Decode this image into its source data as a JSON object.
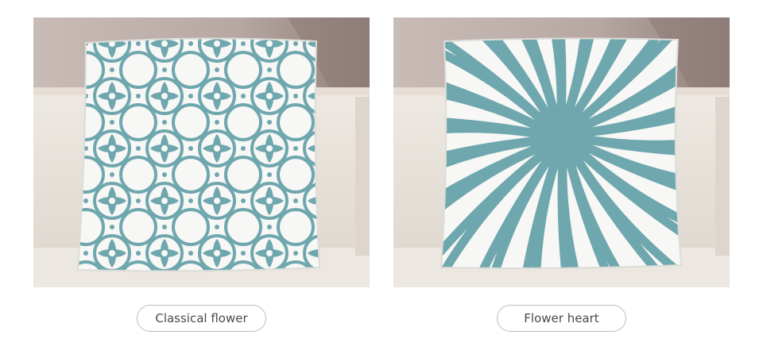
{
  "products": [
    {
      "label": "Classical flower",
      "pattern": "quatrefoil-lattice-icon"
    },
    {
      "label": "Flower heart",
      "pattern": "sunburst-icon"
    }
  ],
  "colors": {
    "teal": "#6fa7ae",
    "pillow_white": "#f6f6f4",
    "sofa": "#e9e3dc",
    "wall": "#b8aaa6",
    "pill_border": "#bdbdbd",
    "pill_text": "#4a4a4a"
  }
}
